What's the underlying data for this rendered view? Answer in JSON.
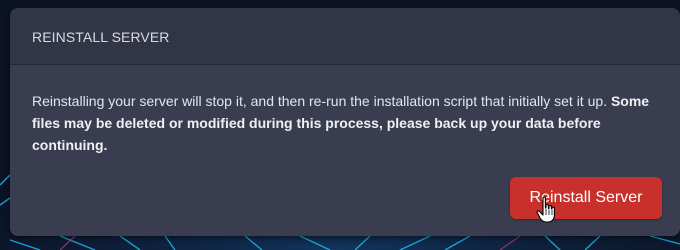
{
  "card": {
    "title": "REINSTALL SERVER",
    "body_text": "Reinstalling your server will stop it, and then re-run the installation script that initially set it up.",
    "body_warning": "Some files may be deleted or modified during this process, please back up your data before continuing.",
    "button_label": "Reinstall Server"
  },
  "colors": {
    "card_bg": "#393d4f",
    "header_bg": "#323546",
    "button": "#c8302b",
    "page_bg": "#0b1224",
    "accent_lines": "#1fb6e8"
  },
  "icons": {
    "cursor": "hand-pointer-cursor"
  }
}
